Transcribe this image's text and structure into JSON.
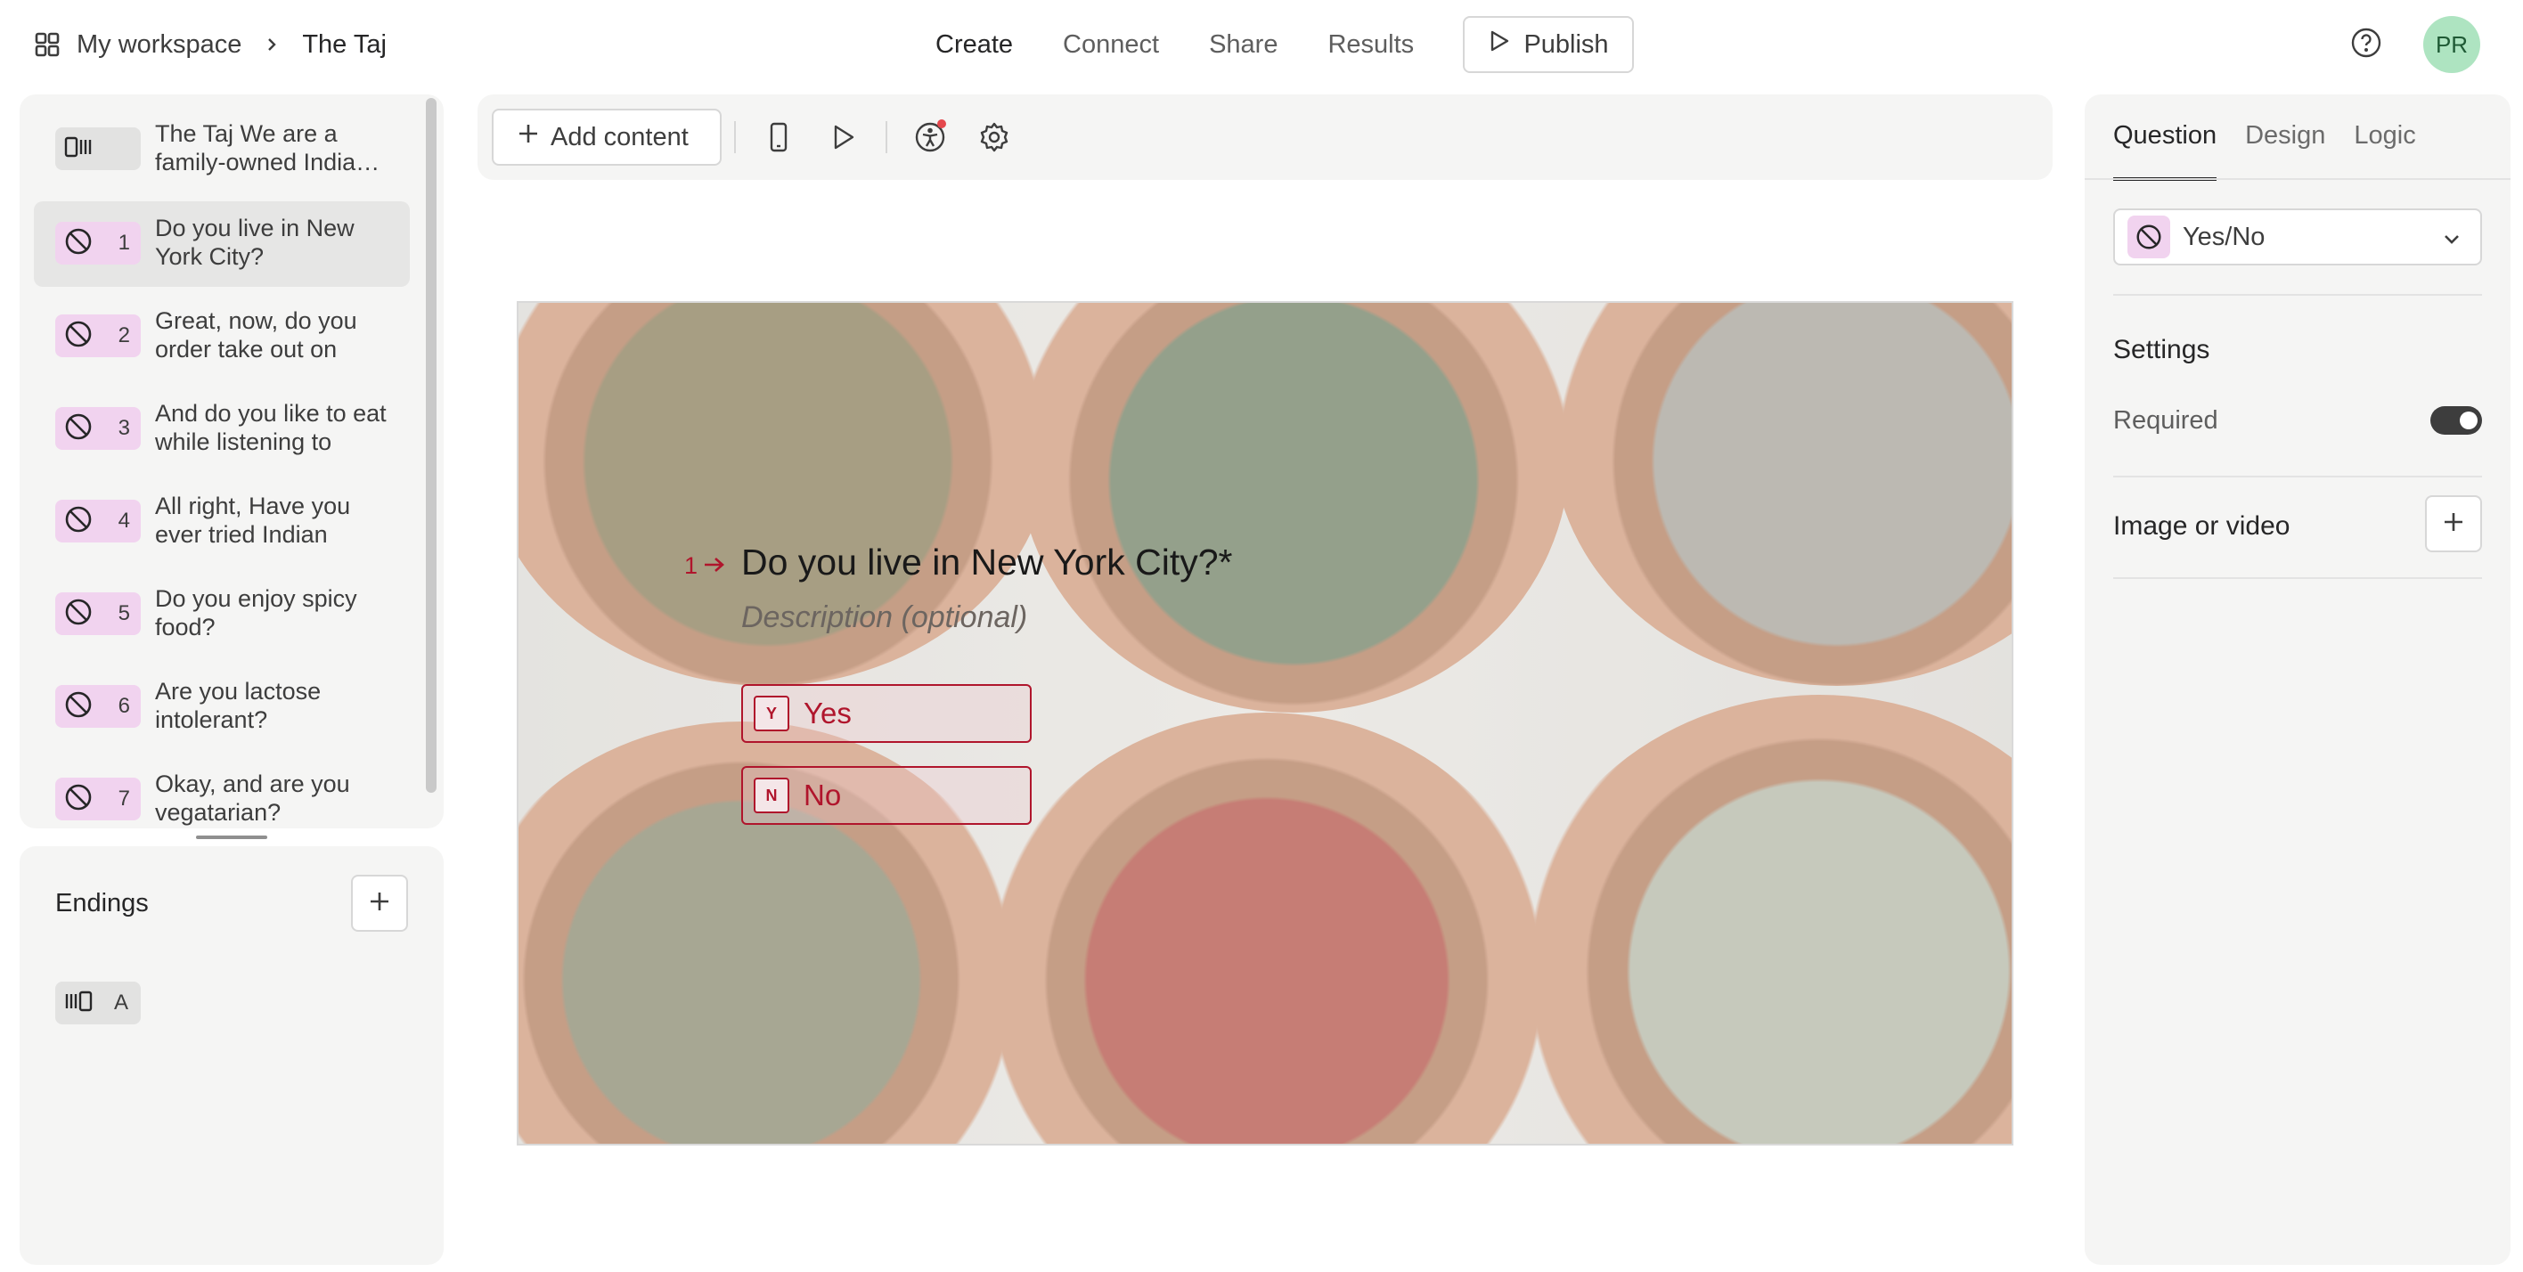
{
  "breadcrumb": {
    "workspace": "My workspace",
    "form_name": "The Taj"
  },
  "nav": {
    "create": "Create",
    "connect": "Connect",
    "share": "Share",
    "results": "Results",
    "publish": "Publish"
  },
  "user": {
    "initials": "PR"
  },
  "sidebar": {
    "items": [
      {
        "num": "",
        "type": "welcome-screen",
        "text": "The Taj We are a family-owned Indian restaurant"
      },
      {
        "num": "1",
        "type": "yes-no",
        "text": "Do you live in New York City?"
      },
      {
        "num": "2",
        "type": "yes-no",
        "text": "Great, now, do you order take out on"
      },
      {
        "num": "3",
        "type": "yes-no",
        "text": "And do you like to eat while listening to"
      },
      {
        "num": "4",
        "type": "yes-no",
        "text": "All right, Have you ever tried Indian"
      },
      {
        "num": "5",
        "type": "yes-no",
        "text": "Do you enjoy spicy food?"
      },
      {
        "num": "6",
        "type": "yes-no",
        "text": "Are you lactose intolerant?"
      },
      {
        "num": "7",
        "type": "yes-no",
        "text": "Okay, and are you vegatarian?"
      }
    ],
    "selected_index": 1
  },
  "endings": {
    "title": "Endings",
    "items": [
      {
        "label": "A"
      }
    ]
  },
  "toolbar": {
    "add_content": "Add content"
  },
  "question": {
    "number": "1",
    "title": "Do you live in New York City?*",
    "description_placeholder": "Description (optional)",
    "choices": [
      {
        "key": "Y",
        "label": "Yes"
      },
      {
        "key": "N",
        "label": "No"
      }
    ]
  },
  "right_panel": {
    "tabs": [
      "Question",
      "Design",
      "Logic"
    ],
    "active_tab": "Question",
    "type_label": "Yes/No",
    "settings_title": "Settings",
    "required_label": "Required",
    "required_on": true,
    "media_label": "Image or video"
  },
  "colors": {
    "accent": "#b0152c",
    "question_badge": "#f1d3ef",
    "panel_bg": "#f5f5f4",
    "avatar_bg": "#aee4c1"
  }
}
